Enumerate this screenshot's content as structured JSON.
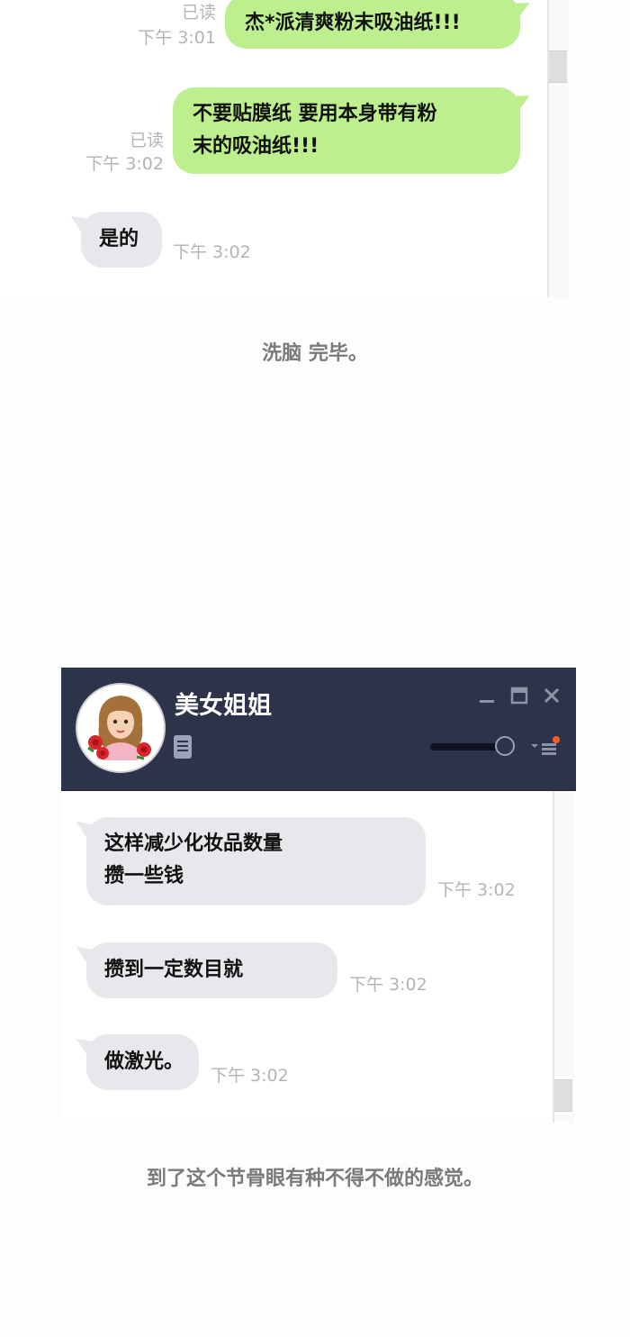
{
  "screen1": {
    "messages": [
      {
        "text": "杰*派清爽粉末吸油纸!!!",
        "read": "已读",
        "time": "下午 3:01"
      },
      {
        "lines": [
          "不要贴膜纸 要用本身带有粉",
          "末的吸油纸!!!"
        ],
        "read": "已读",
        "time": "下午 3:02"
      },
      {
        "text": "是的",
        "time": "下午 3:02"
      }
    ]
  },
  "caption1": "洗脑 完毕。",
  "screen2": {
    "contact_name": "美女姐姐",
    "icons": [
      "avatar-portrait",
      "document-icon",
      "minimize-icon",
      "maximize-icon",
      "close-icon",
      "volume-slider",
      "menu-icon"
    ],
    "messages": [
      {
        "lines": [
          "这样减少化妆品数量",
          "攒一些钱"
        ],
        "time": "下午 3:02"
      },
      {
        "text": "攒到一定数目就",
        "time": "下午 3:02"
      },
      {
        "text": "做激光。",
        "time": "下午 3:02"
      }
    ],
    "colors": {
      "titlebar": "#2d3349",
      "incoming_bubble": "#e6e8ec",
      "outgoing_bubble": "#bdef8f",
      "notification_dot": "#ff5a1f"
    }
  },
  "caption2": "到了这个节骨眼有种不得不做的感觉。"
}
